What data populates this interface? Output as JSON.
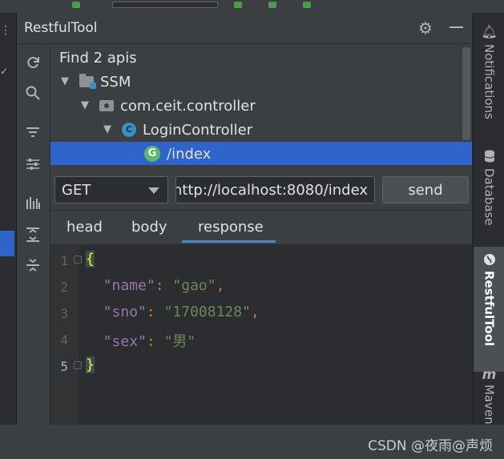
{
  "window": {
    "title": "RestfulTool"
  },
  "header_icons": [
    "gear-icon",
    "minimize-icon"
  ],
  "toolbar_icons": [
    "refresh-icon",
    "search-icon",
    "filter-icon",
    "settings-sliders-icon",
    "bar-chart-icon",
    "expand-all-icon",
    "collapse-all-icon"
  ],
  "tree": {
    "summary": "Find 2 apis",
    "nodes": [
      {
        "label": "SSM",
        "icon": "module-folder-icon"
      },
      {
        "label": "com.ceit.controller",
        "icon": "package-icon"
      },
      {
        "label": "LoginController",
        "icon": "class-icon",
        "icon_letter": "C"
      },
      {
        "label": "/index",
        "icon": "get-method-icon",
        "icon_letter": "G",
        "selected": true
      }
    ]
  },
  "request": {
    "method": "GET",
    "url": "http://localhost:8080/index",
    "url_visible": "nttp://localhost:8080/index",
    "send_label": "send"
  },
  "tabs": [
    {
      "label": "head"
    },
    {
      "label": "body"
    },
    {
      "label": "response",
      "active": true
    }
  ],
  "editor": {
    "line_numbers": [
      "1",
      "2",
      "3",
      "4",
      "5"
    ],
    "lines": [
      {
        "open": "{"
      },
      {
        "key": "\"name\"",
        "colon": ": ",
        "value": "\"gao\"",
        "comma": ","
      },
      {
        "key": "\"sno\"",
        "colon": ": ",
        "value": "\"17008128\"",
        "comma": ","
      },
      {
        "key": "\"sex\"",
        "colon": ": ",
        "value": "\"男\""
      },
      {
        "close": "}"
      }
    ]
  },
  "right_stripe": [
    {
      "label": "Notifications",
      "icon": "bell-icon"
    },
    {
      "label": "Database",
      "icon": "database-icon"
    },
    {
      "label": "RestfulTool",
      "icon": "globe-icon",
      "active": true
    },
    {
      "label": "Maven",
      "icon": "maven-icon",
      "icon_letter": "m"
    }
  ],
  "watermark": "CSDN @夜雨@声烦",
  "colors": {
    "selection": "#2f65ca",
    "tab_underline": "#4a88c7",
    "json_key": "#9876aa",
    "json_string": "#6a8759",
    "brace": "#ffef28"
  }
}
